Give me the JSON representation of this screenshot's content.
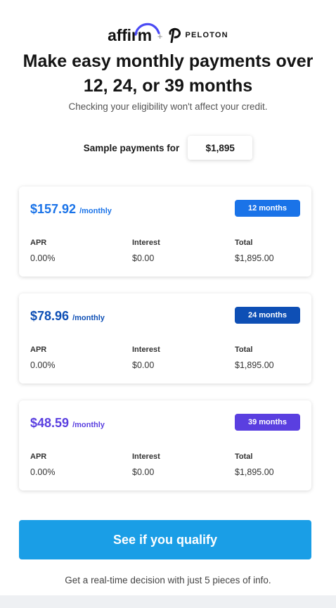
{
  "brand": {
    "affirm_name": "affirm",
    "separator": "+",
    "partner_name": "PELOTON"
  },
  "colors": {
    "cta": "#1a9ee6",
    "plan_12": "#1a73e8",
    "plan_24": "#0e4fb5",
    "plan_39": "#5a3fe0"
  },
  "icons": [
    "affirm-arc-icon",
    "peloton-p-icon"
  ],
  "headline": "Make easy monthly payments over 12, 24, or 39 months",
  "subhead": "Checking your eligibility won't affect your credit.",
  "sample": {
    "label": "Sample payments for",
    "value": "$1,895"
  },
  "plans": [
    {
      "amount": "$157.92",
      "per": "/monthly",
      "term": "12 months",
      "apr_label": "APR",
      "apr": "0.00%",
      "interest_label": "Interest",
      "interest": "$0.00",
      "total_label": "Total",
      "total": "$1,895.00"
    },
    {
      "amount": "$78.96",
      "per": "/monthly",
      "term": "24 months",
      "apr_label": "APR",
      "apr": "0.00%",
      "interest_label": "Interest",
      "interest": "$0.00",
      "total_label": "Total",
      "total": "$1,895.00"
    },
    {
      "amount": "$48.59",
      "per": "/monthly",
      "term": "39 months",
      "apr_label": "APR",
      "apr": "0.00%",
      "interest_label": "Interest",
      "interest": "$0.00",
      "total_label": "Total",
      "total": "$1,895.00"
    }
  ],
  "cta_label": "See if you qualify",
  "footnote": "Get a real-time decision with just 5 pieces of info."
}
